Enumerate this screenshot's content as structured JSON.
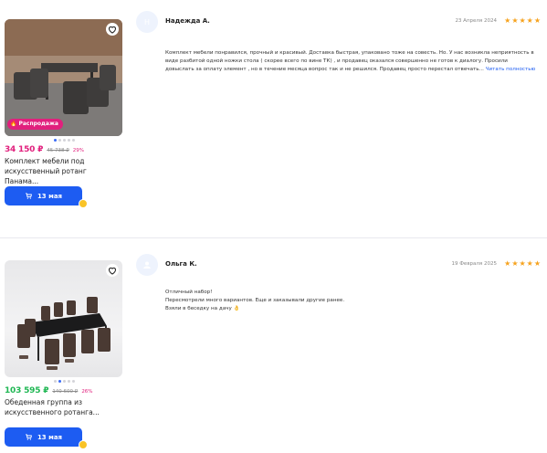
{
  "cards": [
    {
      "product": {
        "badge": "Распродажа",
        "price": "34 150 ₽",
        "old_price": "45 738 ₽",
        "discount": "29%",
        "title_line1": "Комплект мебели под",
        "title_line2": "искусственный ротанг Панама...",
        "delivery": "13 мая",
        "dots": 5,
        "active_dot": 0
      },
      "review": {
        "avatar_letter": "Н",
        "author": "Надежда А.",
        "date": "23 Апреля 2024",
        "rating": 5,
        "text": "Комплект мебели понравился, прочный и красивый. Доставка быстрая, упаковано тоже на совесть. Но. У нас возникла неприятность в виде разбитой одной ножки стола ( скорее всего по вине ТК) , и продавец оказался совершенно не готов к диалогу. Просили довыслать за оплату элемент , но в течение месяца вопрос так и не решился. Продавец просто перестал отвечать...",
        "read_more": "Читать полностью"
      }
    },
    {
      "product": {
        "price": "103 595 ₽",
        "old_price": "140 600 ₽",
        "discount": "26%",
        "title_line1": "Обеденная группа из",
        "title_line2": "искусственного ротанга...",
        "delivery": "13 мая",
        "dots": 5,
        "active_dot": 1
      },
      "review": {
        "author": "Ольга К.",
        "date": "19 Февраля 2025",
        "rating": 5,
        "lines": [
          "Отличный набор!",
          "Пересмотрели много вариантов. Еще и заказывали другие ранее.",
          "Взяли в беседку на дачу 👌"
        ]
      }
    }
  ],
  "colors": {
    "sale_price": "#e1207d",
    "green_price": "#1fb753",
    "button": "#1d5cf2",
    "star": "#f6a21d"
  },
  "icons": {
    "favorite": "heart-outline-icon",
    "cart": "cart-icon",
    "fire": "fire-icon",
    "star": "star-icon",
    "avatar_placeholder": "user-icon"
  }
}
